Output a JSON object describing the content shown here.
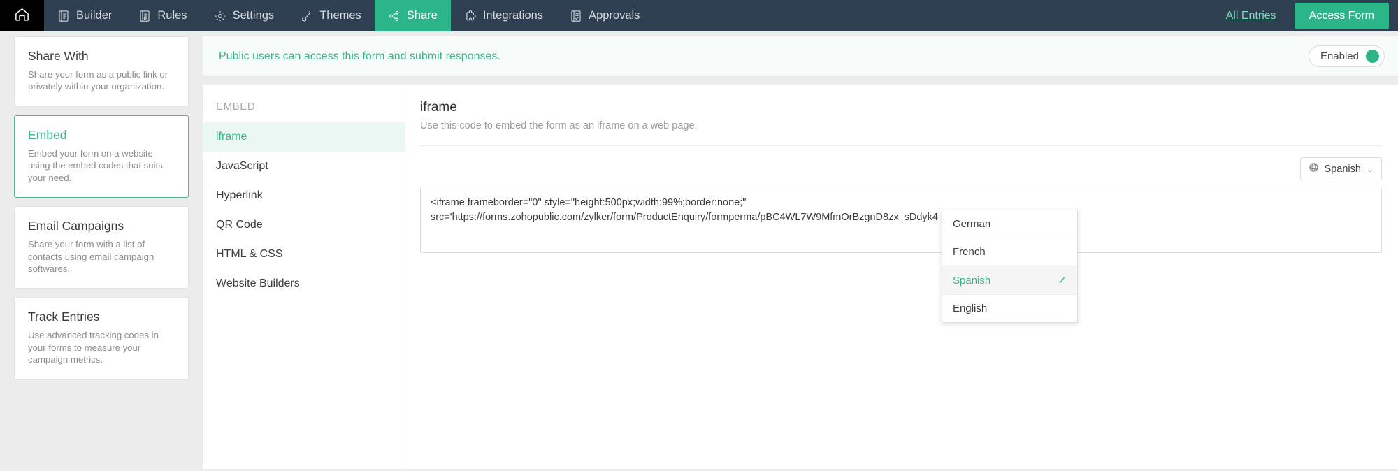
{
  "topnav": {
    "home_icon": "home-icon",
    "items": [
      {
        "label": "Builder",
        "icon": "form-builder-icon",
        "active": false
      },
      {
        "label": "Rules",
        "icon": "rules-icon",
        "active": false
      },
      {
        "label": "Settings",
        "icon": "gear-icon",
        "active": false
      },
      {
        "label": "Themes",
        "icon": "brush-icon",
        "active": false
      },
      {
        "label": "Share",
        "icon": "share-nodes-icon",
        "active": true
      },
      {
        "label": "Integrations",
        "icon": "puzzle-icon",
        "active": false
      },
      {
        "label": "Approvals",
        "icon": "approval-icon",
        "active": false
      }
    ],
    "all_entries_label": "All Entries",
    "access_form_label": "Access Form"
  },
  "sidebar": {
    "cards": [
      {
        "title": "Share With",
        "desc": "Share your form as a public link or privately within your organization.",
        "selected": false
      },
      {
        "title": "Embed",
        "desc": "Embed your form on a website using the embed codes that suits your need.",
        "selected": true
      },
      {
        "title": "Email Campaigns",
        "desc": "Share your form with a list of contacts using email campaign softwares.",
        "selected": false
      },
      {
        "title": "Track Entries",
        "desc": "Use advanced tracking codes in your forms to measure your campaign metrics.",
        "selected": false
      }
    ]
  },
  "banner": {
    "message": "Public users can access this form and submit responses.",
    "toggle_label": "Enabled",
    "toggle_on": true,
    "accent_color": "#2bb588"
  },
  "submenu": {
    "heading": "EMBED",
    "items": [
      {
        "label": "iframe",
        "active": true
      },
      {
        "label": "JavaScript",
        "active": false
      },
      {
        "label": "Hyperlink",
        "active": false
      },
      {
        "label": "QR Code",
        "active": false
      },
      {
        "label": "HTML & CSS",
        "active": false
      },
      {
        "label": "Website Builders",
        "active": false
      }
    ]
  },
  "panel": {
    "title": "iframe",
    "description": "Use this code to embed the form as an iframe on a web page.",
    "language_selected": "Spanish",
    "globe_icon": "globe-icon",
    "chevron_icon": "chevron-down-icon",
    "code": "<iframe frameborder=\"0\" style=\"height:500px;width:99%;border:none;\"\nsrc='https://forms.zohopublic.com/zylker/form/ProductEnquiry/formperma/pBC4WL7W9MfmOrBzgnD8zx_sDdyk4_0dY"
  },
  "language_dropdown": {
    "open": true,
    "options": [
      {
        "label": "German",
        "selected": false
      },
      {
        "label": "French",
        "selected": false
      },
      {
        "label": "Spanish",
        "selected": true
      },
      {
        "label": "English",
        "selected": false
      }
    ],
    "check_glyph": "✓"
  }
}
